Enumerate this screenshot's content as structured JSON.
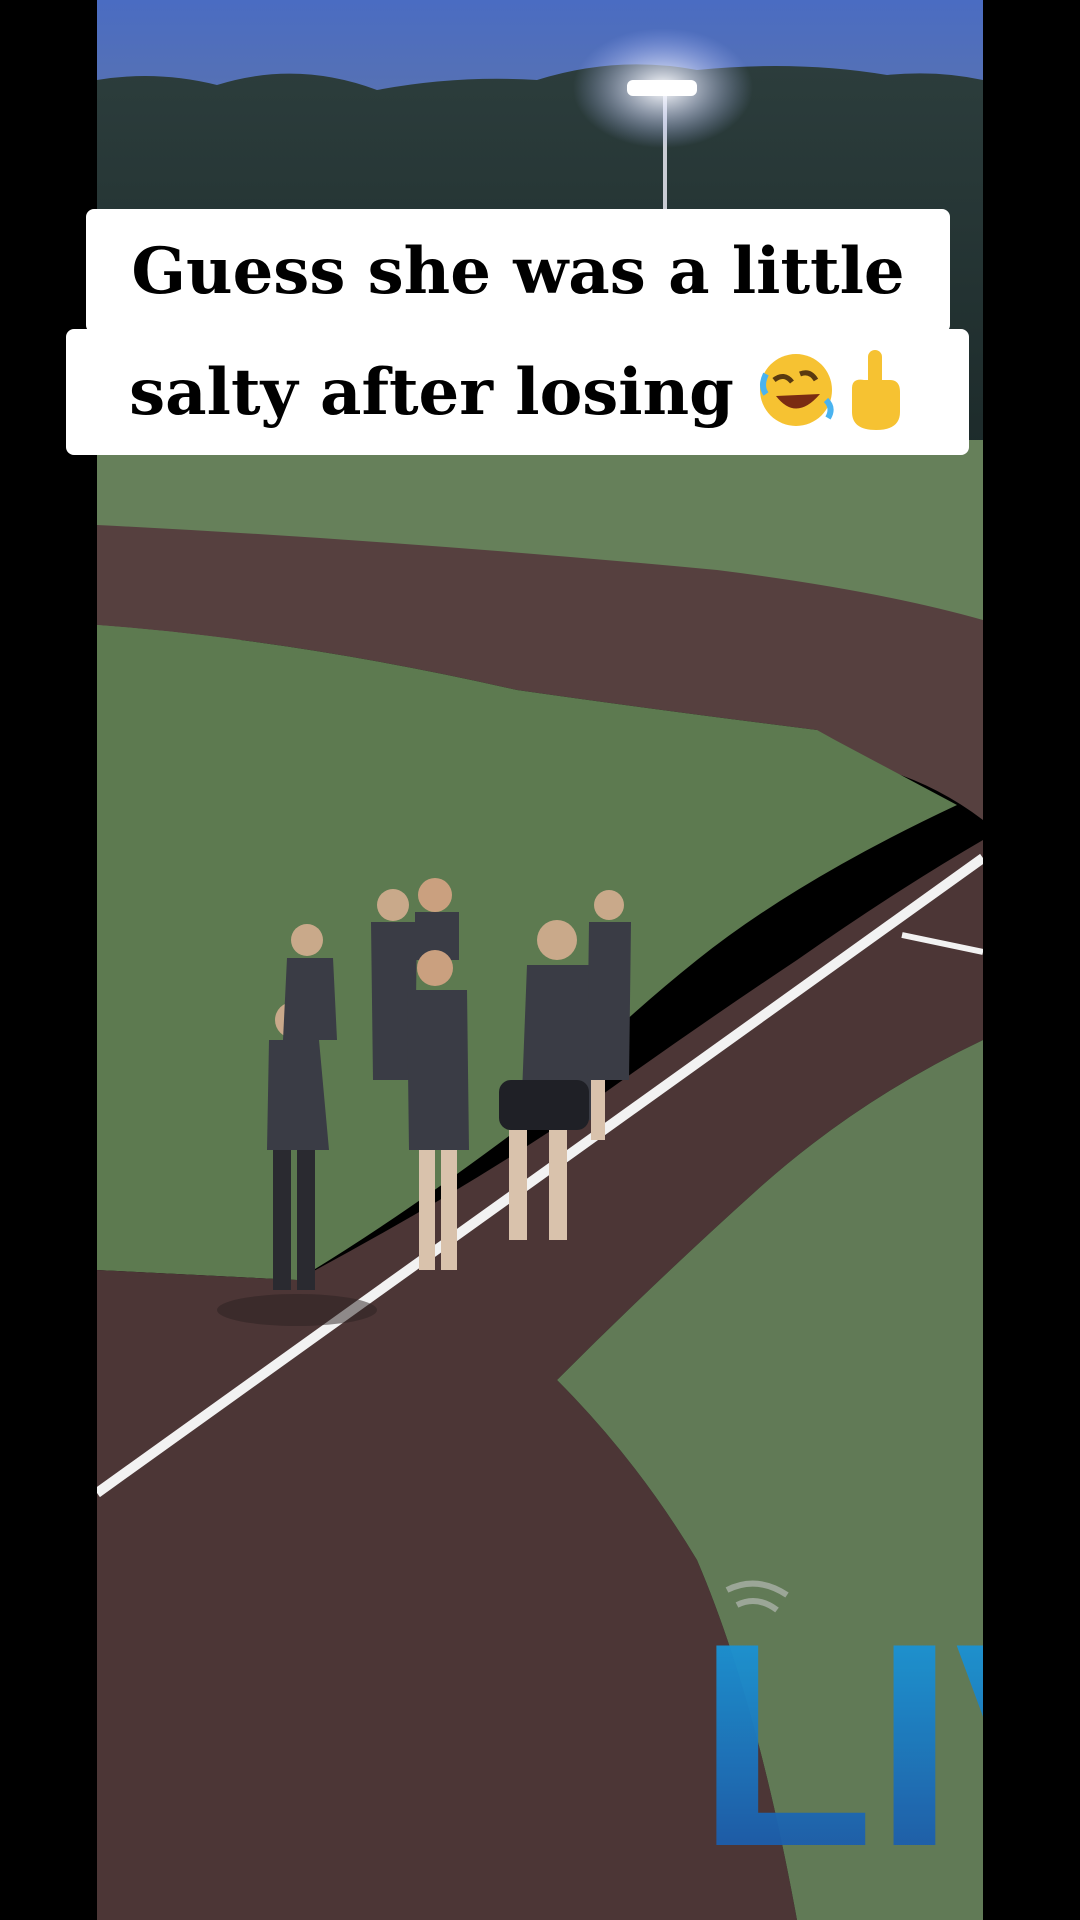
{
  "caption": {
    "line1": "Guess she was a little",
    "line2": "salty after losing"
  },
  "icons": {
    "emoji_1": "rolling-on-floor-laughing-emoji",
    "emoji_2": "middle-finger-emoji"
  },
  "watermark": {
    "text": "LIV",
    "icon": "broadcast-signal-icon",
    "color": "#1f8ad6"
  },
  "colors": {
    "sky": "#3d5fb4",
    "grass": "#5f7a52",
    "dirt": "#4f3a3c",
    "caption_bg": "#ffffff"
  }
}
